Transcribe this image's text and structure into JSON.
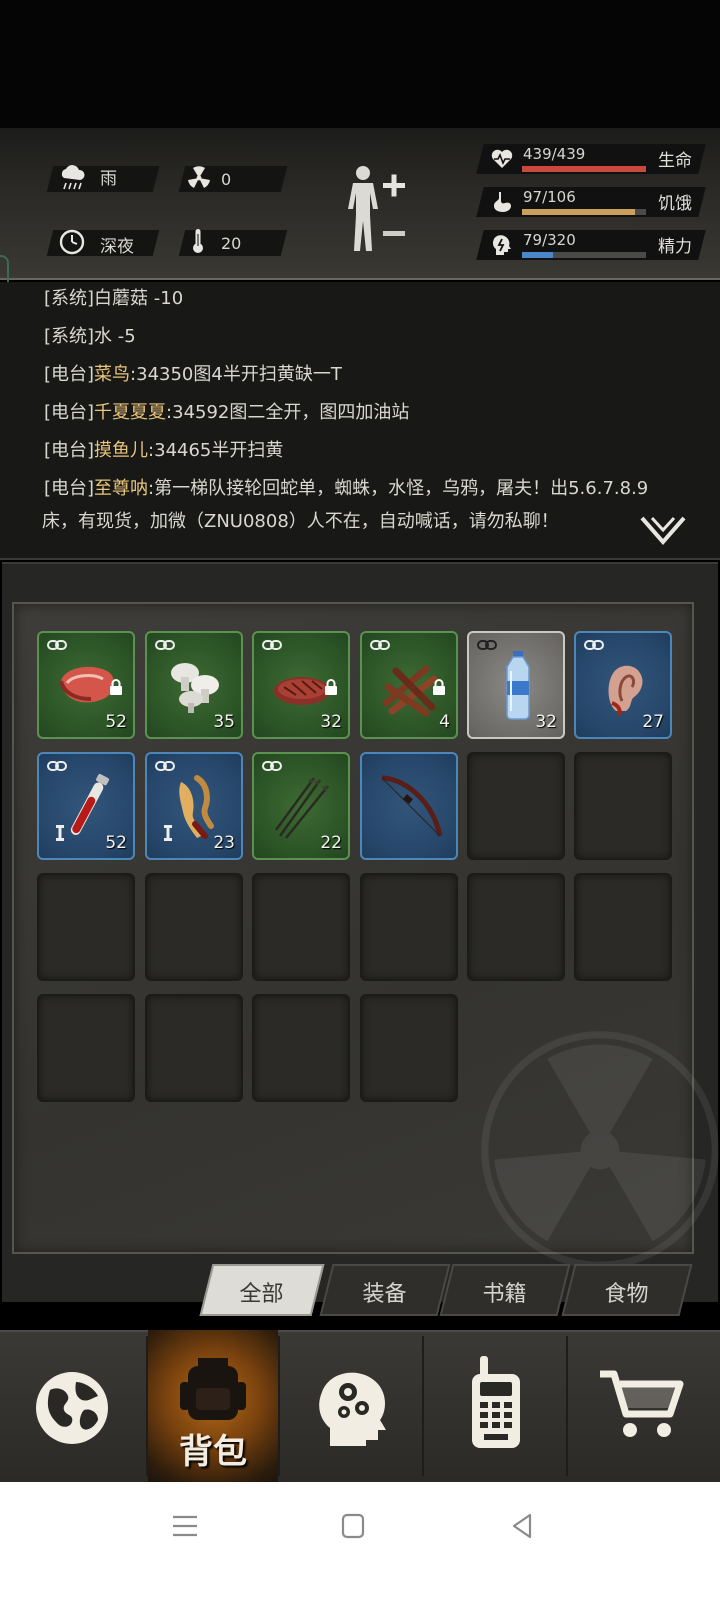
{
  "status": {
    "weather": "雨",
    "radiation": "0",
    "time_of_day": "深夜",
    "temperature": "20",
    "health": {
      "value": "439/439",
      "label": "生命",
      "fraction": 1.0,
      "color": "#c94a3c"
    },
    "hunger": {
      "value": "97/106",
      "label": "饥饿",
      "fraction": 0.915,
      "color": "#c9a15a"
    },
    "energy": {
      "value": "79/320",
      "label": "精力",
      "fraction": 0.247,
      "color": "#4a86c9"
    }
  },
  "chat": [
    {
      "channel": "[系统]",
      "name": "",
      "text": "白蘑菇 -10"
    },
    {
      "channel": "[系统]",
      "name": "",
      "text": "水 -5"
    },
    {
      "channel": "[电台]",
      "name": "菜鸟",
      "text": ":34350图4半开扫黄缺一T"
    },
    {
      "channel": "[电台]",
      "name": "千夏夏夏",
      "text": ":34592图二全开，图四加油站"
    },
    {
      "channel": "[电台]",
      "name": "摸鱼儿",
      "text": ":34465半开扫黄"
    },
    {
      "channel": "[电台]",
      "name": "至尊呐",
      "text": ":第一梯队接轮回蛇单，蜘蛛，水怪，乌鸦，屠夫！出5.6.7.8.9"
    },
    {
      "channel": "",
      "name": "",
      "text": "床，有现货，加微（ZNU0808）人不在，自动喊话，请勿私聊！"
    }
  ],
  "inventory": {
    "items": [
      {
        "icon": "raw-steak-icon",
        "qty": "52",
        "rarity": "green",
        "locked": true
      },
      {
        "icon": "mushroom-icon",
        "qty": "35",
        "rarity": "green",
        "locked": false
      },
      {
        "icon": "cooked-meat-icon",
        "qty": "32",
        "rarity": "green",
        "locked": true
      },
      {
        "icon": "jerky-icon",
        "qty": "4",
        "rarity": "green",
        "locked": true
      },
      {
        "icon": "water-bottle-icon",
        "qty": "32",
        "rarity": "white",
        "locked": false
      },
      {
        "icon": "ear-icon",
        "qty": "27",
        "rarity": "blue",
        "locked": false
      },
      {
        "icon": "blood-vial-icon",
        "qty": "52",
        "rarity": "blue",
        "locked": false
      },
      {
        "icon": "claw-icon",
        "qty": "23",
        "rarity": "blue",
        "locked": false
      },
      {
        "icon": "arrows-icon",
        "qty": "22",
        "rarity": "green",
        "locked": false
      },
      {
        "icon": "bow-icon",
        "qty": "",
        "rarity": "blue",
        "locked": false
      }
    ],
    "empty_slots": 12
  },
  "tabs": [
    {
      "label": "全部",
      "active": true
    },
    {
      "label": "装备",
      "active": false
    },
    {
      "label": "书籍",
      "active": false
    },
    {
      "label": "食物",
      "active": false
    }
  ],
  "nav": {
    "backpack_label": "背包"
  }
}
